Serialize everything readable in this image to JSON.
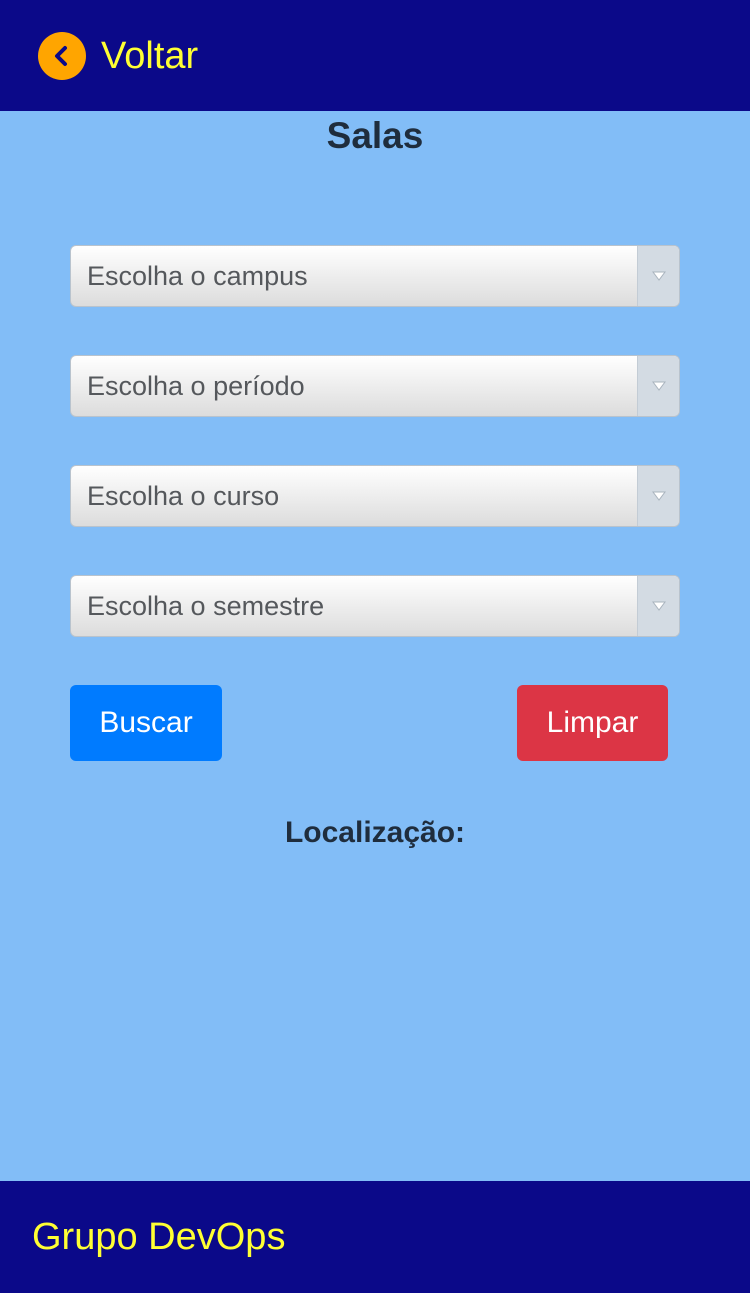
{
  "header": {
    "back_label": "Voltar",
    "back_icon": "chevron-left-icon"
  },
  "main": {
    "title": "Salas",
    "selects": [
      {
        "label": "Escolha o campus",
        "icon": "dropdown-arrow-icon"
      },
      {
        "label": "Escolha o período",
        "icon": "dropdown-arrow-icon"
      },
      {
        "label": "Escolha o curso",
        "icon": "dropdown-arrow-icon"
      },
      {
        "label": "Escolha o semestre",
        "icon": "dropdown-arrow-icon"
      }
    ],
    "search_label": "Buscar",
    "clear_label": "Limpar",
    "location_label": "Localização:"
  },
  "footer": {
    "text": "Grupo DevOps"
  },
  "colors": {
    "header_bg": "#0b0989",
    "page_bg": "#82bdf7",
    "accent_text": "#ffff33",
    "back_icon_bg": "#ffa500",
    "search_button": "#007bff",
    "clear_button": "#dc3545"
  }
}
